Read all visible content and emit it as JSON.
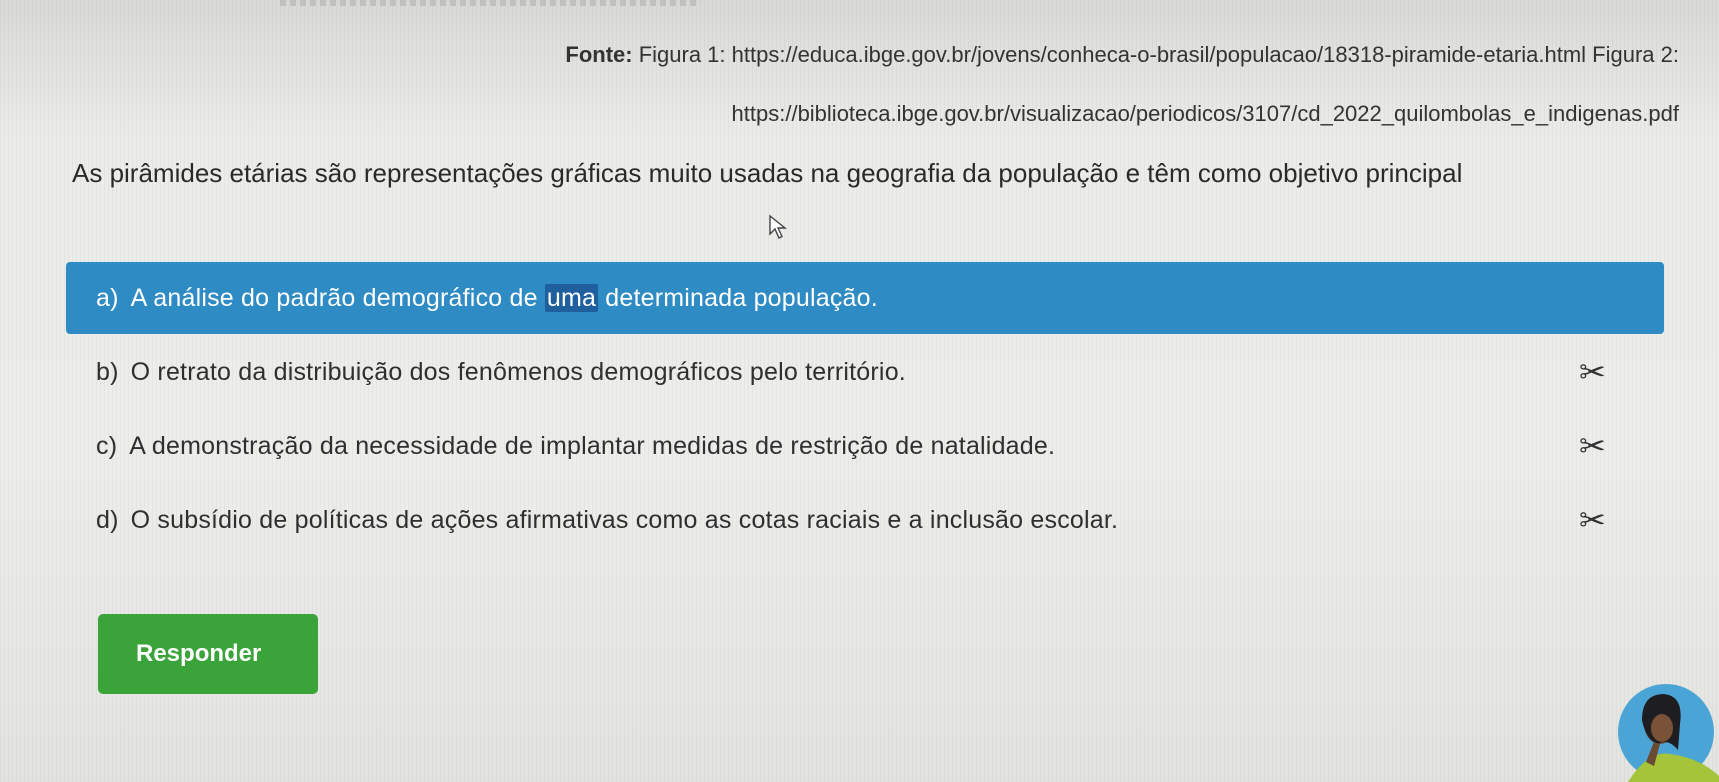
{
  "source": {
    "line1_label": "Fonte:",
    "line1_text": " Figura 1: https://educa.ibge.gov.br/jovens/conheca-o-brasil/populacao/18318-piramide-etaria.html Figura 2:",
    "line2_text": "https://biblioteca.ibge.gov.br/visualizacao/periodicos/3107/cd_2022_quilombolas_e_indigenas.pdf"
  },
  "question": {
    "text": "As pirâmides etárias são representações gráficas muito usadas na geografia da população e têm como objetivo principal"
  },
  "options": [
    {
      "letter": "a)",
      "text_before": "A análise do padrão demográfico de ",
      "text_highlight": "uma",
      "text_after": " determinada população.",
      "selected": true
    },
    {
      "letter": "b)",
      "text": "O retrato da distribuição dos fenômenos demográficos pelo território.",
      "eliminate_icon": "scissors-icon"
    },
    {
      "letter": "c)",
      "text": "A demonstração da necessidade de implantar medidas de restrição de natalidade.",
      "eliminate_icon": "scissors-icon"
    },
    {
      "letter": "d)",
      "text": "O subsídio de políticas de ações afirmativas como as cotas raciais e a inclusão escolar.",
      "eliminate_icon": "scissors-icon"
    }
  ],
  "submit": {
    "label": "Responder"
  },
  "icons": {
    "eliminate_glyph": "✂",
    "mouse_cursor": "cursor-icon",
    "mascot": "mascot-avatar"
  },
  "colors": {
    "selected_option": "#2f8bc3",
    "submit_button": "#3aa43a",
    "background": "#ecece9"
  }
}
